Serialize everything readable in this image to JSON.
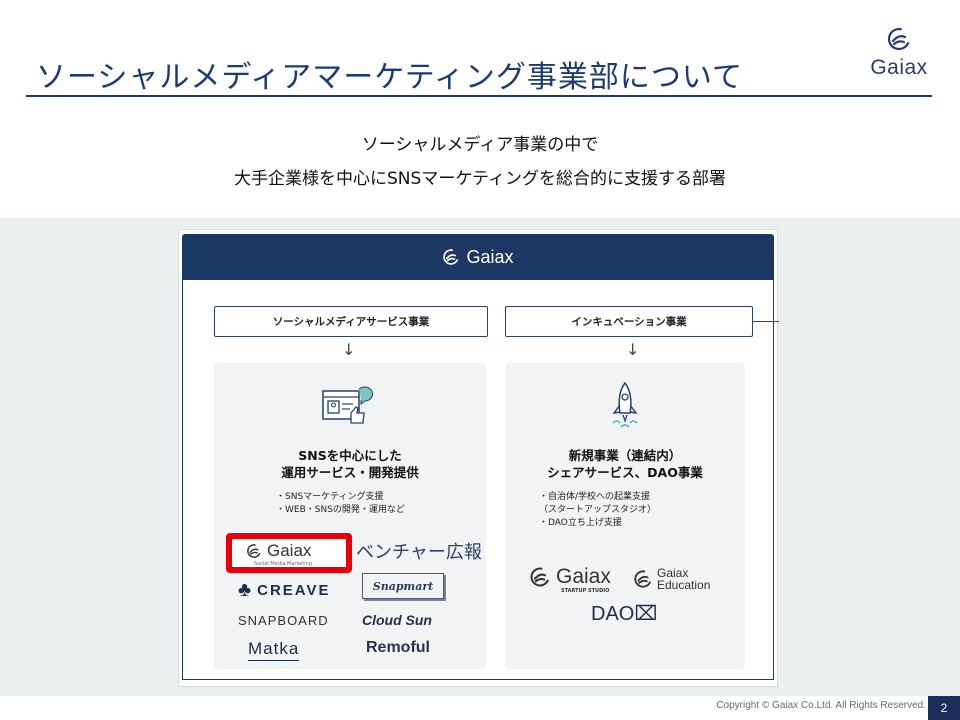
{
  "header": {
    "title": "ソーシャルメディアマーケティング事業部について",
    "logo_text": "Gaiax",
    "logo_icon": "gaiax-swirl-icon"
  },
  "lead": {
    "line1": "ソーシャルメディア事業の中で",
    "line2": "大手企業様を中心にSNSマーケティングを総合的に支援する部署"
  },
  "org_chart": {
    "company": "Gaiax",
    "divisions": [
      {
        "label": "ソーシャルメディアサービス事業",
        "icon": "social-media-profile-icon",
        "title_line1": "SNSを中心にした",
        "title_line2": "運用サービス・開発提供",
        "bullets": [
          "・SNSマーケティング支援",
          "・WEB・SNSの開発・運用など"
        ],
        "brands": {
          "gaiax_smm": "Gaiax",
          "gaiax_smm_sub": "Social Media Marketing",
          "venture": "ベンチャー広報",
          "creave": "CREAVE",
          "snapmart": "Snapmart",
          "snapboard": "SNAPBOARD",
          "cloudsun": "Cloud Sun",
          "matka": "Matka",
          "remoful": "Remoful"
        },
        "highlighted_brand": "gaiax_smm"
      },
      {
        "label": "インキュベーション事業",
        "icon": "rocket-icon",
        "title_line1": "新規事業（連結内）",
        "title_line2": "シェアサービス、DAO事業",
        "bullets": [
          "・自治体/学校への起業支援",
          "（スタートアップスタジオ）",
          "・DAO立ち上げ支援"
        ],
        "brands": {
          "startup": "Gaiax",
          "startup_sub": "STARTUP STUDIO",
          "edu_line1": "Gaiax",
          "edu_line2": "Education",
          "dao": "DAO"
        }
      }
    ]
  },
  "footer": {
    "copyright": "Copyright © Gaiax Co.Ltd. All Rights Reserved.",
    "page_number": "2"
  },
  "colors": {
    "title": "#1b3a78",
    "header_bar": "#1d3764",
    "highlight": "#e8000b",
    "band": "#e9f0ef"
  }
}
